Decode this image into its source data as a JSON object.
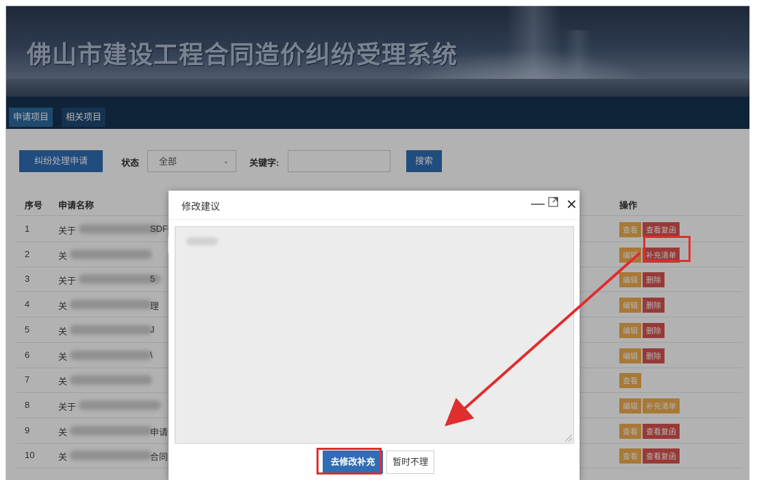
{
  "app": {
    "title": "佛山市建设工程合同造价纠纷受理系统"
  },
  "nav": {
    "tabs": [
      {
        "label": "申请项目",
        "active": true
      },
      {
        "label": "相关项目",
        "active": false
      }
    ]
  },
  "toolbar": {
    "apply_button": "纠纷处理申请",
    "status_label": "状态",
    "status_value": "全部",
    "keyword_label": "关键字:",
    "keyword_value": "",
    "search_button": "搜索"
  },
  "table": {
    "headers": {
      "index": "序号",
      "name": "申请名称",
      "actions": "操作"
    },
    "rows": [
      {
        "num": "1",
        "name_visible": "关于",
        "name_suffix": "SDFGE",
        "actions": [
          {
            "label": "查看",
            "color": "orange"
          },
          {
            "label": "查看复函",
            "color": "red"
          }
        ]
      },
      {
        "num": "2",
        "name_visible": "关",
        "name_suffix": "",
        "actions": [
          {
            "label": "编辑",
            "color": "orange"
          },
          {
            "label": "补充清单",
            "color": "red"
          }
        ]
      },
      {
        "num": "3",
        "name_visible": "关于",
        "name_suffix": "5",
        "actions": [
          {
            "label": "编辑",
            "color": "orange"
          },
          {
            "label": "删除",
            "color": "red"
          }
        ]
      },
      {
        "num": "4",
        "name_visible": "关",
        "name_suffix": "理",
        "actions": [
          {
            "label": "编辑",
            "color": "orange"
          },
          {
            "label": "删除",
            "color": "red"
          }
        ]
      },
      {
        "num": "5",
        "name_visible": "关",
        "name_suffix": "J",
        "actions": [
          {
            "label": "编辑",
            "color": "orange"
          },
          {
            "label": "删除",
            "color": "red"
          }
        ]
      },
      {
        "num": "6",
        "name_visible": "关",
        "name_suffix": "\\",
        "actions": [
          {
            "label": "编辑",
            "color": "orange"
          },
          {
            "label": "删除",
            "color": "red"
          }
        ]
      },
      {
        "num": "7",
        "name_visible": "关",
        "name_suffix": "",
        "actions": [
          {
            "label": "查看",
            "color": "orange"
          }
        ]
      },
      {
        "num": "8",
        "name_visible": "关于",
        "name_suffix": "",
        "actions": [
          {
            "label": "编辑",
            "color": "orange"
          },
          {
            "label": "补充清单",
            "color": "orange"
          }
        ]
      },
      {
        "num": "9",
        "name_visible": "关",
        "name_suffix": "申请",
        "actions": [
          {
            "label": "查看",
            "color": "orange"
          },
          {
            "label": "查看复函",
            "color": "red"
          }
        ]
      },
      {
        "num": "10",
        "name_visible": "关",
        "name_suffix": "合同",
        "actions": [
          {
            "label": "查看",
            "color": "orange"
          },
          {
            "label": "查看复函",
            "color": "red"
          }
        ]
      }
    ]
  },
  "dialog": {
    "title": "修改建议",
    "minimize_icon": "minimize-icon",
    "maximize_icon": "maximize-icon",
    "close_icon": "close-icon",
    "content": "",
    "primary_button": "去修改补充",
    "secondary_button": "暂时不理"
  },
  "colors": {
    "primary": "#2f6db5",
    "orange": "#f0ad4e",
    "red": "#d9534f",
    "annotation": "#e02d2d",
    "navbar": "#163352"
  }
}
